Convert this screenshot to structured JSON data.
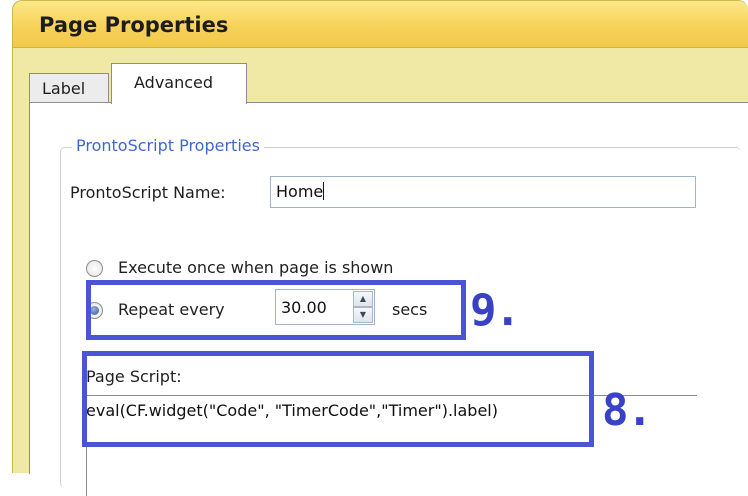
{
  "window": {
    "title": "Page Properties"
  },
  "tabs": [
    {
      "label": "Label",
      "active": false
    },
    {
      "label": "Advanced",
      "active": true
    }
  ],
  "group": {
    "legend": "ProntoScript Properties",
    "name_label": "ProntoScript Name:",
    "name_value": "Home"
  },
  "execution": {
    "once_label": "Execute once when page is shown",
    "once_selected": false,
    "repeat_label": "Repeat every",
    "repeat_selected": true,
    "repeat_value": "30.00",
    "repeat_unit": "secs"
  },
  "page_script": {
    "label": "Page Script:",
    "text": "eval(CF.widget(\"Code\", \"TimerCode\",\"Timer\").label)"
  },
  "annotations": [
    {
      "label": "9."
    },
    {
      "label": "8."
    }
  ],
  "colors": {
    "titlebar": "#f6d25a",
    "accent_legend": "#3f68cf",
    "callout": "#4b54d4"
  }
}
